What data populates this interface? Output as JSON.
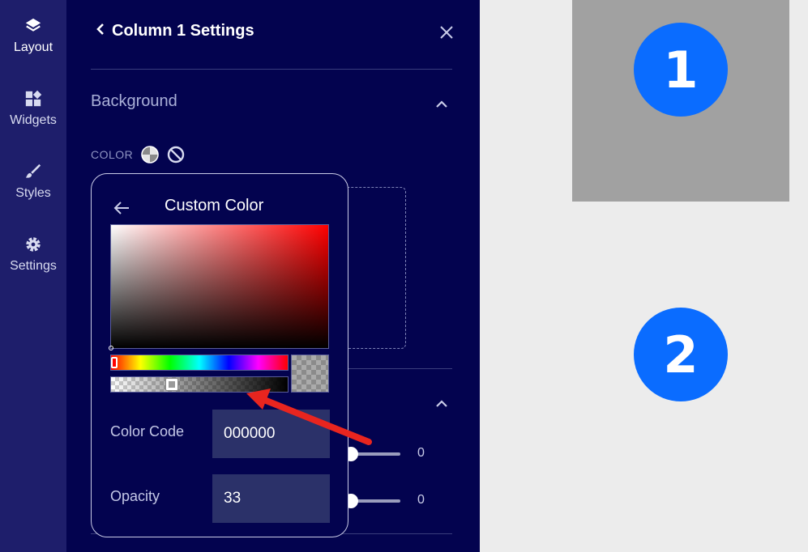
{
  "rail": {
    "items": [
      {
        "label": "Layout",
        "icon": "layers-icon"
      },
      {
        "label": "Widgets",
        "icon": "widgets-icon"
      },
      {
        "label": "Styles",
        "icon": "brush-icon"
      },
      {
        "label": "Settings",
        "icon": "gear-icon"
      }
    ]
  },
  "panel": {
    "title": "Column 1 Settings",
    "section_title": "Background",
    "color_label": "COLOR"
  },
  "color_picker": {
    "title": "Custom Color",
    "color_code_label": "Color Code",
    "color_code_value": "000000",
    "opacity_label": "Opacity",
    "opacity_value": "33",
    "alpha_level": 0.33
  },
  "sliders": {
    "values": [
      "0",
      "0"
    ]
  },
  "preview": {
    "badge_1": "1",
    "badge_2": "2"
  },
  "colors": {
    "rail_bg": "#1e1e6b",
    "panel_bg": "#03034f",
    "accent_blue": "#0a6cff",
    "arrow_red": "#e8251f"
  }
}
